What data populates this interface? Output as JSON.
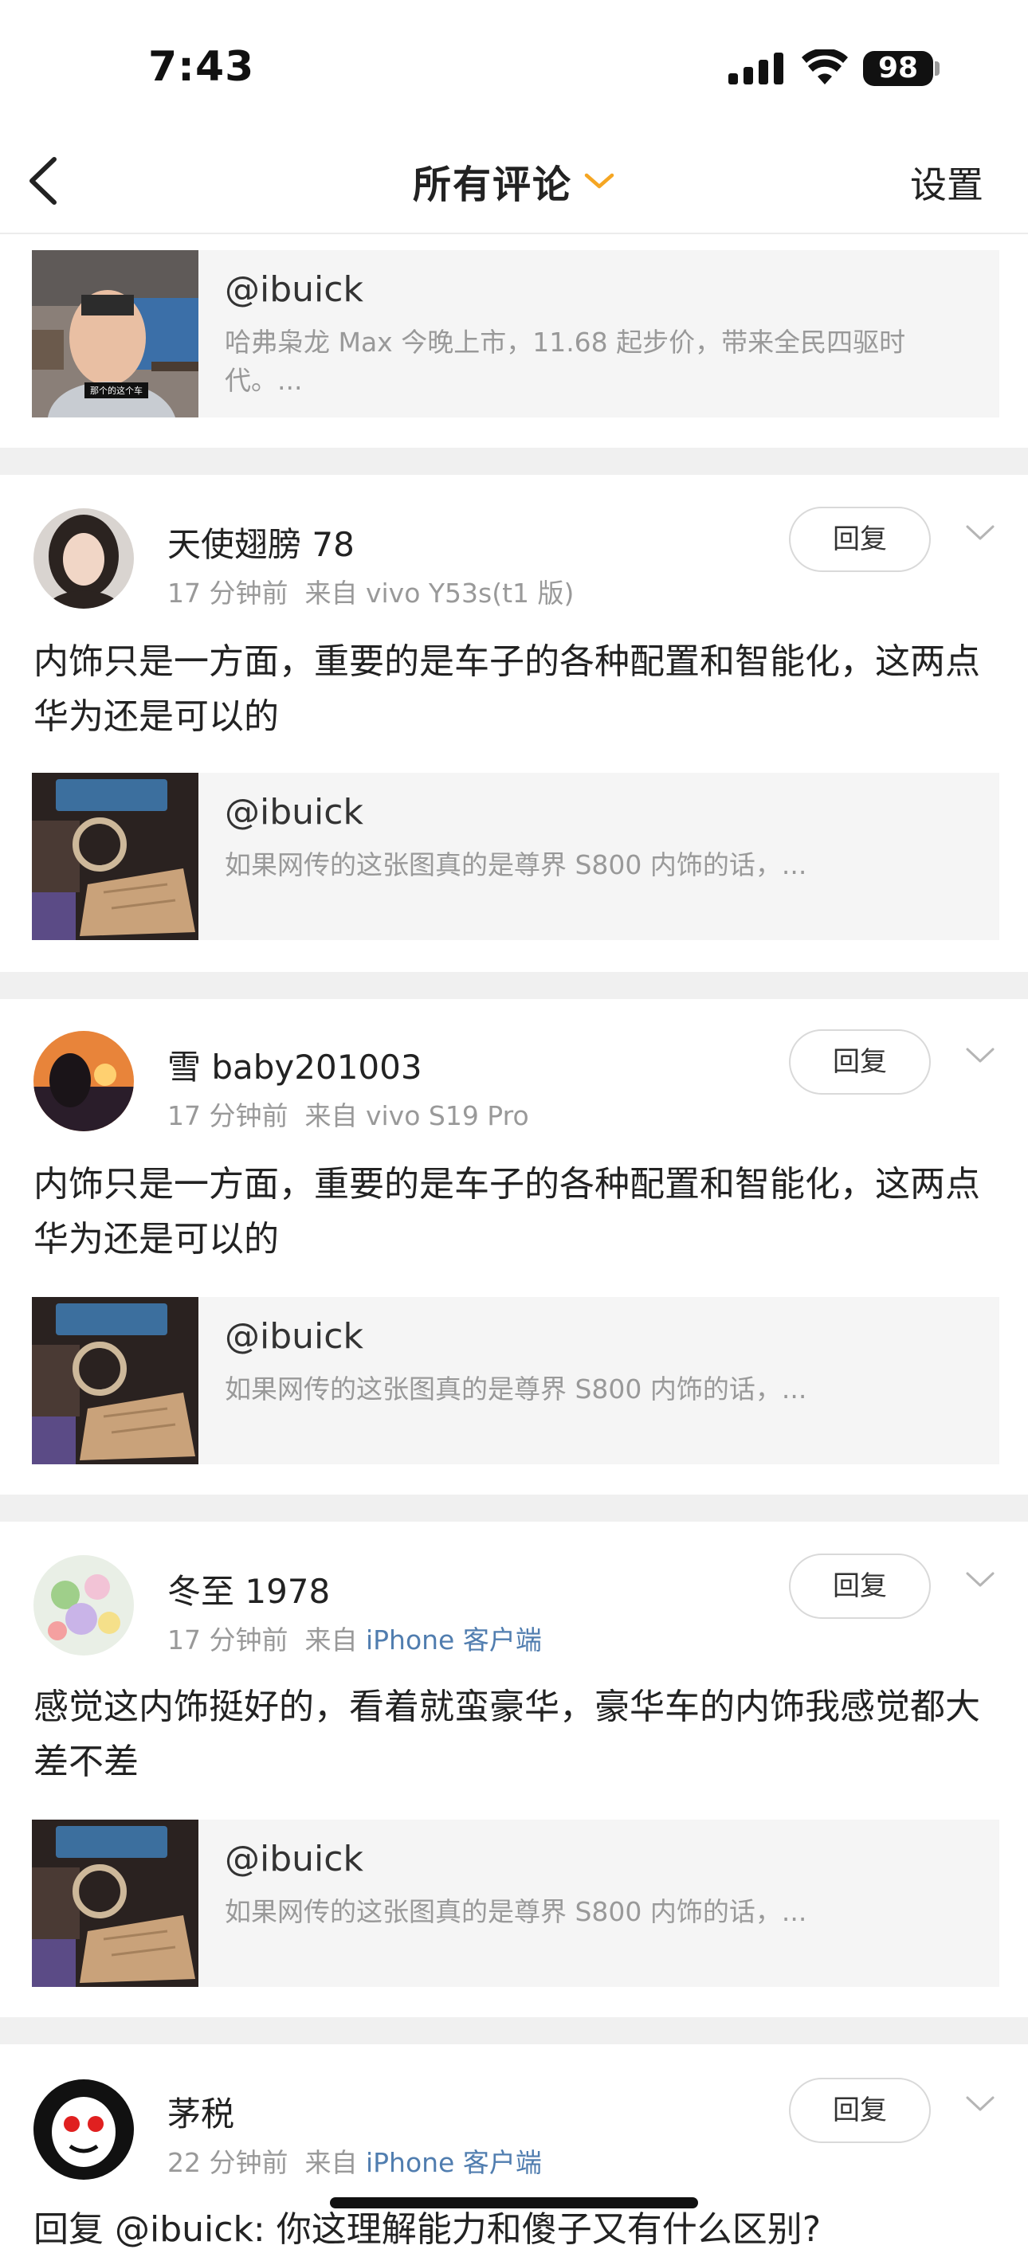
{
  "status_bar": {
    "time": "7:43",
    "battery": "98",
    "icons": [
      "signal-icon",
      "wifi-icon",
      "battery-icon"
    ]
  },
  "header": {
    "back_icon": "chevron-left-icon",
    "title": "所有评论",
    "title_icon": "chevron-down-icon",
    "settings": "设置",
    "accent_color": "#f5a623"
  },
  "top_card": {
    "author": "@ibuick",
    "excerpt": "哈弗枭龙 Max 今晚上市，11.68 起步价，带来全民四驱时代。...",
    "thumb_caption": "那个的这个车"
  },
  "comments": [
    {
      "username": "天使翅膀 78",
      "time": "17 分钟前",
      "source_prefix": "来自",
      "source": "vivo Y53s(t1 版)",
      "reply_label": "回复",
      "text": "内饰只是一方面，重要的是车子的各种配置和智能化，这两点华为还是可以的",
      "card": {
        "author": "@ibuick",
        "excerpt": "如果网传的这张图真的是尊界 S800 内饰的话，...",
        "thumb": "car-interior-image"
      }
    },
    {
      "username": "雪 baby201003",
      "time": "17 分钟前",
      "source_prefix": "来自",
      "source": "vivo S19 Pro",
      "reply_label": "回复",
      "text": "内饰只是一方面，重要的是车子的各种配置和智能化，这两点华为还是可以的",
      "card": {
        "author": "@ibuick",
        "excerpt": "如果网传的这张图真的是尊界 S800 内饰的话，...",
        "thumb": "car-interior-image"
      }
    },
    {
      "username": "冬至 1978",
      "time": "17 分钟前",
      "source_prefix": "来自",
      "source": "iPhone 客户端",
      "reply_label": "回复",
      "text": "感觉这内饰挺好的，看着就蛮豪华，豪华车的内饰我感觉都大差不差",
      "card": {
        "author": "@ibuick",
        "excerpt": "如果网传的这张图真的是尊界 S800 内饰的话，...",
        "thumb": "car-interior-image"
      }
    },
    {
      "username": "茅税",
      "time": "22 分钟前",
      "source_prefix": "来自",
      "source": "iPhone 客户端",
      "reply_label": "回复",
      "text": "回复 @ibuick: 你这理解能力和傻子又有什么区别?"
    }
  ],
  "colors": {
    "link": "#507daf",
    "meta": "#999999",
    "separator": "#f0f0f0"
  }
}
